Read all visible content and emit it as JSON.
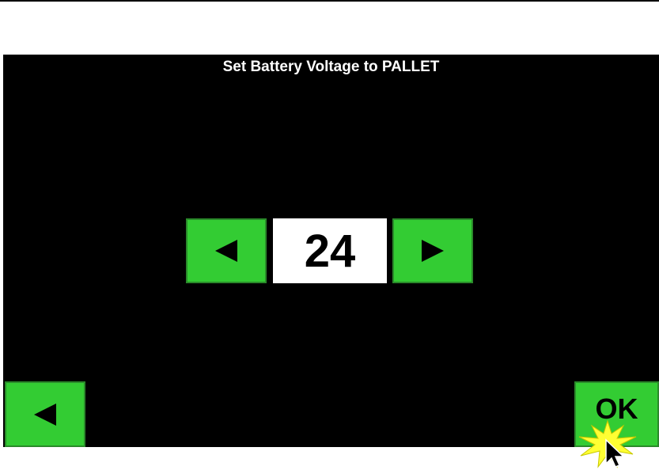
{
  "dialog": {
    "title": "Set Battery Voltage to PALLET"
  },
  "voltage_selector": {
    "value": "24",
    "decrease_icon": "triangle-left-icon",
    "increase_icon": "triangle-right-icon"
  },
  "footer": {
    "back_icon": "triangle-left-icon",
    "ok_label": "OK"
  },
  "colors": {
    "screen_bg": "#000000",
    "button_green": "#33cc33",
    "value_bg": "#ffffff",
    "click_burst": "#ffff33"
  },
  "cursor": {
    "icon": "mouse-pointer-icon",
    "effect": "click-burst-icon"
  }
}
